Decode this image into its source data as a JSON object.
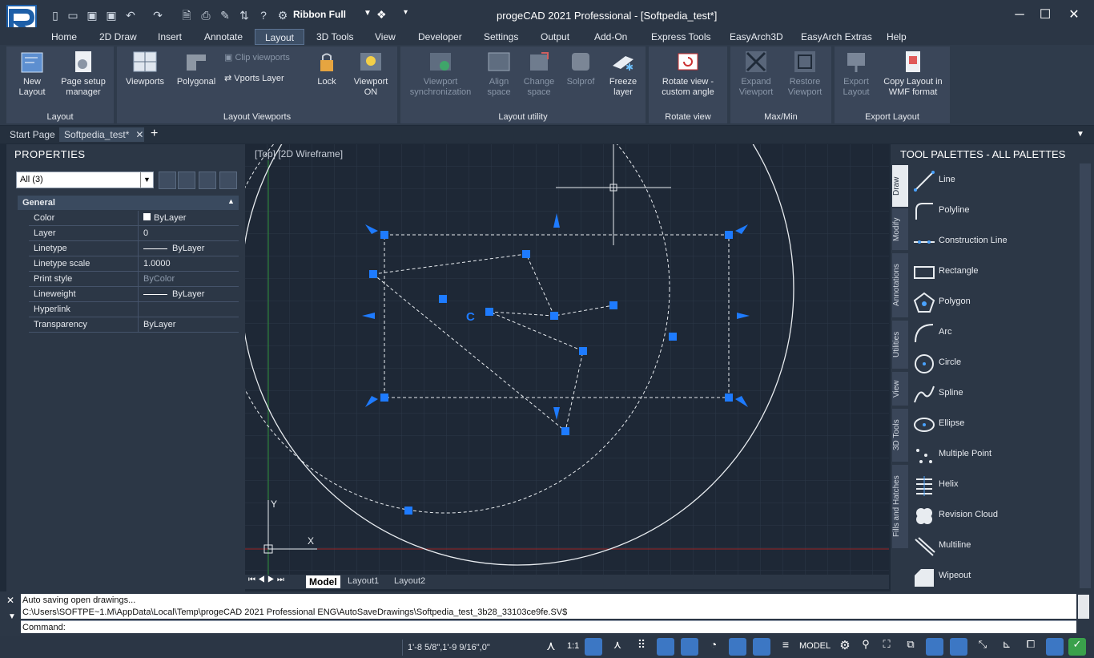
{
  "titlebar": {
    "title": "progeCAD 2021 Professional - [Softpedia_test*]",
    "workspace": "Ribbon Full",
    "quick_access": [
      "new-icon",
      "open-icon",
      "save-icon",
      "saveas-icon",
      "undo-icon",
      "redo-icon",
      "preview-icon",
      "print-icon",
      "match-icon",
      "sync-icon",
      "help-icon",
      "settings-icon"
    ]
  },
  "menu": {
    "tabs": [
      "Home",
      "2D Draw",
      "Insert",
      "Annotate",
      "Layout",
      "3D Tools",
      "View",
      "Developer",
      "Settings",
      "Output",
      "Add-On",
      "Express Tools",
      "EasyArch3D",
      "EasyArch Extras",
      "Help"
    ],
    "active": "Layout"
  },
  "ribbon": {
    "layout_panel": {
      "title": "Layout",
      "new_layout": "New Layout",
      "page_setup": "Page setup manager"
    },
    "viewports_panel": {
      "title": "Layout Viewports",
      "viewports": "Viewports",
      "polygonal": "Polygonal",
      "clip": "Clip viewports",
      "vports_layer": "Vports Layer",
      "lock": "Lock",
      "viewport_on": "Viewport ON"
    },
    "utility_panel": {
      "title": "Layout utility",
      "sync": "Viewport synchronization",
      "align": "Align space",
      "change": "Change space",
      "solprof": "Solprof",
      "freeze": "Freeze layer"
    },
    "rotate_panel": {
      "title": "Rotate view",
      "rotate": "Rotate view - custom angle"
    },
    "maxmin_panel": {
      "title": "Max/Min",
      "expand": "Expand Viewport",
      "restore": "Restore Viewport"
    },
    "export_panel": {
      "title": "Export Layout",
      "export": "Export Layout",
      "copy_wmf": "Copy Layout in WMF format"
    }
  },
  "doctabs": {
    "start": "Start Page",
    "file": "Softpedia_test*"
  },
  "properties": {
    "title": "PROPERTIES",
    "selection": "All (3)",
    "group": "General",
    "rows": [
      {
        "name": "Color",
        "value": "ByLayer"
      },
      {
        "name": "Layer",
        "value": "0"
      },
      {
        "name": "Linetype",
        "value": "ByLayer"
      },
      {
        "name": "Linetype scale",
        "value": "1.0000"
      },
      {
        "name": "Print style",
        "value": "ByColor"
      },
      {
        "name": "Lineweight",
        "value": "ByLayer"
      },
      {
        "name": "Hyperlink",
        "value": ""
      },
      {
        "name": "Transparency",
        "value": "ByLayer"
      }
    ]
  },
  "canvas": {
    "view_label": "[Top] [2D Wireframe]",
    "ucs_y": "Y",
    "ucs_x": "X",
    "layout_tabs": [
      "Model",
      "Layout1",
      "Layout2"
    ]
  },
  "tool_palettes": {
    "title": "TOOL PALETTES - ALL PALETTES",
    "side_tabs": [
      "Draw",
      "Modify",
      "Annotations",
      "Utilities",
      "View",
      "3D Tools",
      "Fills and Hatches"
    ],
    "tools": [
      "Line",
      "Polyline",
      "Construction Line",
      "Rectangle",
      "Polygon",
      "Arc",
      "Circle",
      "Spline",
      "Ellipse",
      "Multiple Point",
      "Helix",
      "Revision Cloud",
      "Multiline",
      "Wipeout"
    ]
  },
  "command": {
    "line1": "Auto saving open drawings...",
    "line2": "C:\\Users\\SOFTPE~1.M\\AppData\\Local\\Temp\\progeCAD 2021 Professional ENG\\AutoSaveDrawings\\Softpedia_test_3b28_33103ce9fe.SV$",
    "prompt": "Command:"
  },
  "status": {
    "coords": "1'-8 5/8\",1'-9 9/16\",0\"",
    "scale": "1:1",
    "model": "MODEL"
  }
}
